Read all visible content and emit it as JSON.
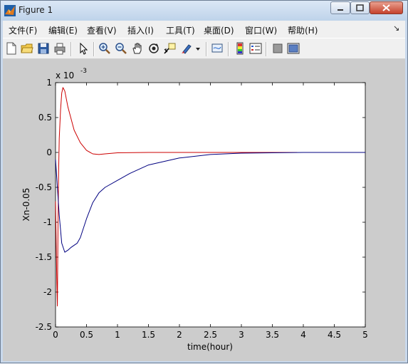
{
  "window": {
    "title": "Figure 1"
  },
  "menu": [
    "文件(F)",
    "编辑(E)",
    "查看(V)",
    "插入(I)",
    "工具(T)",
    "桌面(D)",
    "窗口(W)",
    "帮助(H)"
  ],
  "toolbar_icons": [
    "new-figure-icon",
    "open-file-icon",
    "save-icon",
    "print-icon",
    "pointer-icon",
    "zoom-in-icon",
    "zoom-out-icon",
    "pan-hand-icon",
    "rotate-3d-icon",
    "data-cursor-icon",
    "brush-icon",
    "dropdown-arrow-icon",
    "link-plot-icon",
    "colorbar-icon",
    "legend-icon",
    "hide-plot-tools-icon",
    "show-plot-tools-icon"
  ],
  "axes": {
    "exponent_label": "x 10",
    "exponent_power": "-3",
    "xlabel": "time(hour)",
    "ylabel": "Xn-0.05"
  },
  "chart_data": {
    "type": "line",
    "xlim": [
      0,
      5
    ],
    "ylim": [
      -2.5,
      1
    ],
    "y_scale_factor": "1e-3",
    "xticks": [
      "0",
      "0.5",
      "1",
      "1.5",
      "2",
      "2.5",
      "3",
      "3.5",
      "4",
      "4.5",
      "5"
    ],
    "yticks": [
      "1",
      "0.5",
      "0",
      "-0.5",
      "-1",
      "-1.5",
      "-2",
      "-2.5"
    ],
    "grid": false,
    "series": [
      {
        "color": "#cc0000",
        "x": [
          0,
          0.02,
          0.03,
          0.04,
          0.05,
          0.06,
          0.08,
          0.1,
          0.12,
          0.15,
          0.2,
          0.3,
          0.4,
          0.5,
          0.6,
          0.7,
          0.8,
          1.0,
          1.5,
          2.0,
          3.0,
          3.9
        ],
        "y": [
          -0.7,
          -1.8,
          -2.2,
          -1.0,
          -0.3,
          0.2,
          0.6,
          0.85,
          0.93,
          0.88,
          0.65,
          0.32,
          0.14,
          0.03,
          -0.02,
          -0.03,
          -0.02,
          -0.005,
          0,
          0,
          0,
          0
        ]
      },
      {
        "color": "#000080",
        "x": [
          0,
          0.03,
          0.06,
          0.1,
          0.15,
          0.2,
          0.25,
          0.3,
          0.35,
          0.4,
          0.5,
          0.6,
          0.7,
          0.8,
          1.0,
          1.2,
          1.5,
          2.0,
          2.5,
          3.0,
          4.0,
          5.0
        ],
        "y": [
          -0.1,
          -0.5,
          -0.9,
          -1.3,
          -1.43,
          -1.4,
          -1.36,
          -1.33,
          -1.3,
          -1.22,
          -0.95,
          -0.72,
          -0.58,
          -0.5,
          -0.4,
          -0.3,
          -0.18,
          -0.08,
          -0.03,
          -0.01,
          0,
          0
        ]
      }
    ]
  }
}
